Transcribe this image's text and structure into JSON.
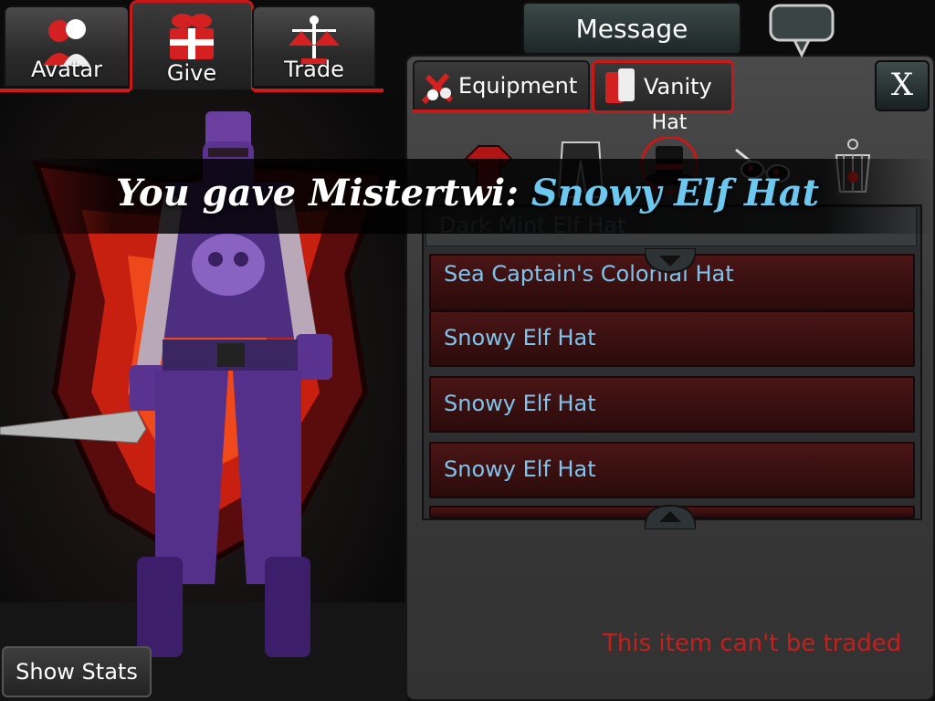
{
  "top_tabs": [
    {
      "label": "Avatar",
      "icon": "avatar-icon",
      "active": false
    },
    {
      "label": "Give",
      "icon": "gift-icon",
      "active": true
    },
    {
      "label": "Trade",
      "icon": "scales-icon",
      "active": false
    }
  ],
  "show_stats_label": "Show Stats",
  "message_label": "Message",
  "sub_tabs": [
    {
      "label": "Equipment",
      "icon": "equipment-icon",
      "active": false
    },
    {
      "label": "Vanity",
      "icon": "vanity-icon",
      "active": true
    }
  ],
  "close_label": "X",
  "category_label": "Hat",
  "categories": [
    "shirt-icon",
    "pants-icon",
    "hat-icon",
    "glasses-icon",
    "lantern-icon"
  ],
  "partial_item": "Dark Mint Elf Hat",
  "items": [
    "Sea Captain's Colonial Hat",
    "Snowy Elf Hat",
    "Snowy Elf Hat",
    "Snowy Elf Hat"
  ],
  "status_text": "This item can't be traded",
  "toast": {
    "prefix": "You gave Mistertwi: ",
    "item": "Snowy Elf Hat"
  },
  "colors": {
    "accent_red": "#c81818",
    "item_text": "#7fc4ee",
    "toast_item": "#6dc8f0",
    "warning": "#c21f1f"
  }
}
